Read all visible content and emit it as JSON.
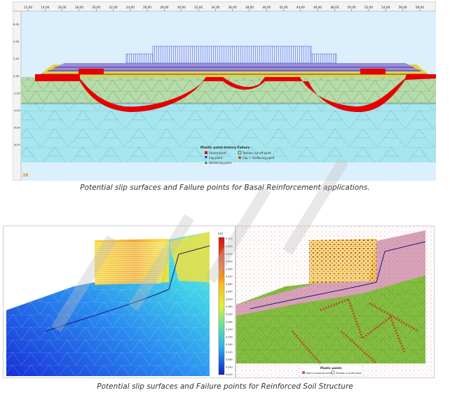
{
  "figure_top": {
    "x_ticks": [
      "12,00",
      "14,00",
      "16,00",
      "18,00",
      "20,00",
      "22,00",
      "24,00",
      "26,00",
      "28,00",
      "30,00",
      "32,00",
      "34,00",
      "36,00",
      "38,00",
      "40,00",
      "42,00",
      "44,00",
      "46,00",
      "48,00",
      "50,00",
      "52,00",
      "54,00",
      "56,00",
      "58,00"
    ],
    "y_ticks": [
      "6,00",
      "4,00",
      "2,00",
      "0,00",
      "-2,00",
      "-4,00",
      "-6,00",
      "-8,00"
    ],
    "legend_title": "Plastic point history Failure",
    "legend_items": [
      {
        "label": "Failure point",
        "symbol": "square",
        "color": "#e00000"
      },
      {
        "label": "Tension cut-off point",
        "symbol": "square-outline",
        "color": "#000000"
      },
      {
        "label": "Cap point",
        "symbol": "triangle-down",
        "color": "#1a1a8c"
      },
      {
        "label": "Cap + hardening point",
        "symbol": "circle",
        "color": "#c05000"
      },
      {
        "label": "Hardening point",
        "symbol": "triangle-up",
        "color": "#1a7a1a"
      }
    ],
    "badge": "38"
  },
  "caption_top": "Potential slip surfaces and Failure points for Basal Reinforcement applications.",
  "figure_left": {
    "colorbar_unit": "[m]",
    "colorbar_ticks": [
      "0,700",
      "0,680",
      "0,640",
      "0,600",
      "0,560",
      "0,520",
      "0,480",
      "0,440",
      "0,400",
      "0,360",
      "0,320",
      "0,280",
      "0,240",
      "0,200",
      "0,160",
      "0,120",
      "0,080",
      "0,040",
      "0,000"
    ]
  },
  "figure_right": {
    "legend_title": "Plastic points",
    "legend_items": [
      {
        "label": "Mohr-Coulomb point",
        "color": "#d05060"
      },
      {
        "label": "Tension cut-off point",
        "color": "#ffffff"
      }
    ]
  },
  "caption_bottom": "Potential slip surfaces and Failure points for Reinforced Soil Structure"
}
